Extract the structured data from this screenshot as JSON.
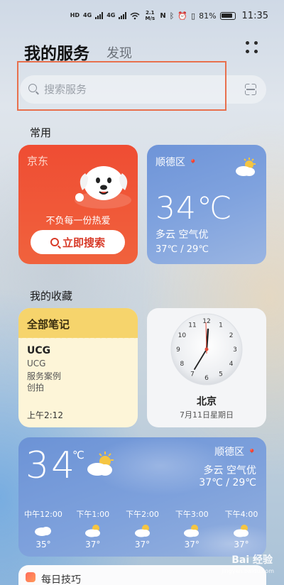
{
  "status_bar": {
    "net1": "HD",
    "net2": "4G",
    "net3": "4G",
    "speed": "2.1 M/s",
    "battery": "81%",
    "time": "11:35"
  },
  "header": {
    "title": "我的服务",
    "tab": "发现"
  },
  "search": {
    "placeholder": "搜索服务"
  },
  "sections": {
    "common": "常用",
    "favorites": "我的收藏"
  },
  "jd": {
    "brand": "京东",
    "tagline": "不负每一份热爱",
    "button": "立即搜索"
  },
  "weather_small": {
    "location": "顺德区",
    "temp": "34℃",
    "condition": "多云 空气优",
    "range": "37℃ / 29℃"
  },
  "notes": {
    "title": "全部笔记",
    "name": "UCG",
    "lines": [
      "UCG",
      "服务案例",
      "创拍"
    ],
    "time": "上午2:12"
  },
  "clock": {
    "city": "北京",
    "date": "7月11日星期日",
    "hour_numerals": [
      "12",
      "1",
      "2",
      "3",
      "4",
      "5",
      "6",
      "7",
      "8",
      "9",
      "10",
      "11"
    ]
  },
  "weather_big": {
    "temp": "34",
    "unit": "℃",
    "location": "顺德区",
    "condition": "多云 空气优",
    "range": "37℃ / 29℃",
    "hourly": [
      {
        "time": "中午12:00",
        "icon": "cloudy-icon",
        "temp": "35°"
      },
      {
        "time": "下午1:00",
        "icon": "partly-cloudy-icon",
        "temp": "37°"
      },
      {
        "time": "下午2:00",
        "icon": "partly-cloudy-icon",
        "temp": "37°"
      },
      {
        "time": "下午3:00",
        "icon": "partly-cloudy-icon",
        "temp": "37°"
      },
      {
        "time": "下午4:00",
        "icon": "partly-cloudy-icon",
        "temp": "37°"
      }
    ]
  },
  "tips": {
    "title": "每日技巧"
  },
  "watermark": {
    "main": "Bai 经验",
    "sub": "jingyan.baidu.com"
  }
}
